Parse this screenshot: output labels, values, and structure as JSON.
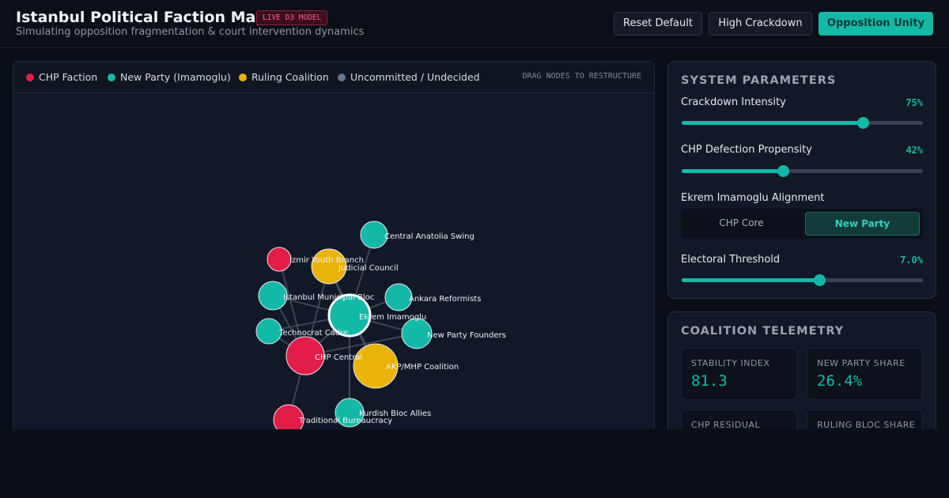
{
  "header": {
    "title": "Istanbul Political Faction Map",
    "badge": "LIVE D3 MODEL",
    "subtitle": "Simulating opposition fragmentation & court intervention dynamics",
    "buttons": {
      "reset": "Reset Default",
      "crackdown": "High Crackdown",
      "unity": "Opposition Unity"
    }
  },
  "legend": [
    {
      "label": "CHP Faction",
      "color": "#e11d48"
    },
    {
      "label": "New Party (Imamoglu)",
      "color": "#14b8a6"
    },
    {
      "label": "Ruling Coalition",
      "color": "#eab308"
    },
    {
      "label": "Uncommitted / Undecided",
      "color": "#64748b"
    }
  ],
  "drag_hint": "DRAG NODES TO RESTRUCTURE",
  "graph": {
    "nodes": [
      {
        "id": "central_anatolia",
        "label": "Central Anatolia Swing",
        "group": "new"
      },
      {
        "id": "izmir",
        "label": "Izmir Youth Branch",
        "group": "chp"
      },
      {
        "id": "judicial",
        "label": "Judicial Council",
        "group": "ruling"
      },
      {
        "id": "istanbul_muni",
        "label": "Istanbul Municipal Bloc",
        "group": "new"
      },
      {
        "id": "ankara",
        "label": "Ankara Reformists",
        "group": "new"
      },
      {
        "id": "imamoglu",
        "label": "Ekrem Imamoglu",
        "group": "new",
        "focus": true
      },
      {
        "id": "technocrat",
        "label": "Technocrat Cadre",
        "group": "new"
      },
      {
        "id": "new_founders",
        "label": "New Party Founders",
        "group": "new"
      },
      {
        "id": "chp_central",
        "label": "CHP Central",
        "group": "chp"
      },
      {
        "id": "akp_mhp",
        "label": "AKP/MHP Coalition",
        "group": "ruling"
      },
      {
        "id": "kurdish",
        "label": "Kurdish Bloc Allies",
        "group": "new"
      },
      {
        "id": "traditional",
        "label": "Traditional Bureaucracy",
        "group": "chp"
      }
    ],
    "links": [
      [
        "imamoglu",
        "central_anatolia"
      ],
      [
        "imamoglu",
        "ankara"
      ],
      [
        "imamoglu",
        "new_founders"
      ],
      [
        "imamoglu",
        "istanbul_muni"
      ],
      [
        "imamoglu",
        "technocrat"
      ],
      [
        "imamoglu",
        "chp_central"
      ],
      [
        "imamoglu",
        "akp_mhp"
      ],
      [
        "imamoglu",
        "kurdish"
      ],
      [
        "imamoglu",
        "judicial"
      ],
      [
        "chp_central",
        "izmir"
      ],
      [
        "chp_central",
        "istanbul_muni"
      ],
      [
        "chp_central",
        "technocrat"
      ],
      [
        "chp_central",
        "traditional"
      ],
      [
        "chp_central",
        "judicial"
      ],
      [
        "chp_central",
        "new_founders"
      ],
      [
        "akp_mhp",
        "judicial"
      ]
    ]
  },
  "parameters": {
    "title": "SYSTEM PARAMETERS",
    "crackdown": {
      "label": "Crackdown Intensity",
      "value": "75%",
      "level": 0.75
    },
    "defection": {
      "label": "CHP Defection Propensity",
      "value": "42%",
      "level": 0.42
    },
    "alignment": {
      "label": "Ekrem Imamoglu Alignment",
      "options": [
        "CHP Core",
        "New Party"
      ],
      "selected": "New Party"
    },
    "threshold": {
      "label": "Electoral Threshold",
      "value": "7.0%",
      "level": 0.57
    }
  },
  "telemetry": {
    "title": "COALITION TELEMETRY",
    "stats": [
      {
        "label": "STABILITY INDEX",
        "value": "81.3"
      },
      {
        "label": "NEW PARTY SHARE",
        "value": "26.4%"
      },
      {
        "label": "CHP RESIDUAL",
        "value": ""
      },
      {
        "label": "RULING BLOC SHARE",
        "value": ""
      }
    ]
  }
}
